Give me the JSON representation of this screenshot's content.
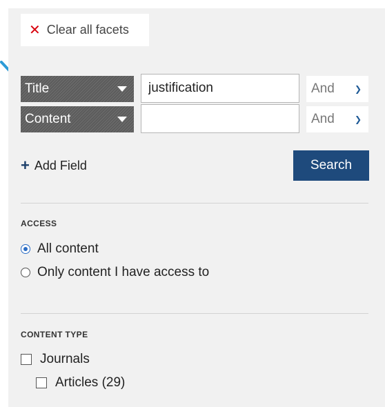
{
  "facets": {
    "clear_label": "Clear all facets",
    "clear_icon": "close-icon"
  },
  "fields": [
    {
      "type": "Title",
      "value": "justification",
      "operator": "And"
    },
    {
      "type": "Content",
      "value": "",
      "operator": "And"
    }
  ],
  "add_field_label": "Add Field",
  "search_label": "Search",
  "access": {
    "title": "ACCESS",
    "options": [
      {
        "label": "All content",
        "selected": true
      },
      {
        "label": "Only content I have access to",
        "selected": false
      }
    ]
  },
  "content_type": {
    "title": "CONTENT TYPE",
    "items": [
      {
        "label": "Journals",
        "checked": false
      },
      {
        "label": "Articles (29)",
        "checked": false
      }
    ]
  },
  "colors": {
    "accent": "#1e4a7c",
    "clear_icon": "#d8000c",
    "radio_selected": "#2a6cc4",
    "pointer_arrow": "#2d9bd7"
  }
}
